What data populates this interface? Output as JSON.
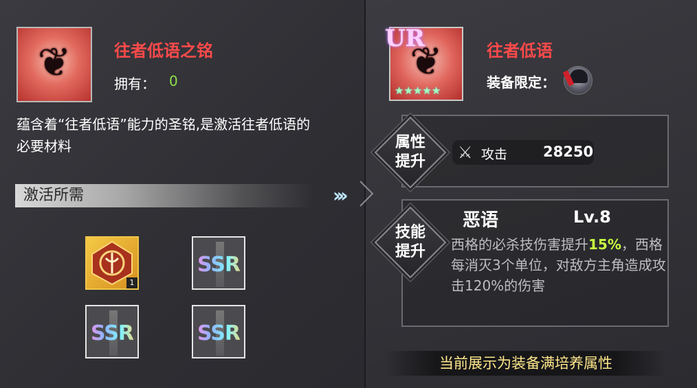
{
  "left": {
    "item_name": "往者低语之铭",
    "owned_label": "拥有：",
    "owned_count": "0",
    "description": "蕴含着“往者低语”能力的圣铭,是激活往者低语的必要材料",
    "requirement_header": "激活所需",
    "materials": [
      {
        "type": "emblem",
        "count": "1"
      },
      {
        "type": "ssr",
        "label": "SSR"
      },
      {
        "type": "ssr",
        "label": "SSR"
      },
      {
        "type": "ssr",
        "label": "SSR"
      }
    ]
  },
  "right": {
    "rarity_badge": "UR",
    "item_name": "往者低语",
    "equip_limit_label": "装备限定：",
    "stars": 5,
    "attr_section_label": "属性\n提升",
    "attr": {
      "name": "攻击",
      "value": "28250"
    },
    "skill_section_label": "技能\n提升",
    "skill": {
      "name": "恶语",
      "level": "Lv.8",
      "desc_prefix": "西格的必杀技伤害提升",
      "desc_highlight": "15%",
      "desc_suffix": "，西格每消灭3个单位，对敌方主角造成攻击120%的伤害"
    },
    "footer_note": "当前展示为装备满培养属性"
  },
  "colors": {
    "title_red": "#ff4a4a",
    "highlight_green": "#c7ff3f",
    "footer_yellow": "#ffe78a"
  }
}
